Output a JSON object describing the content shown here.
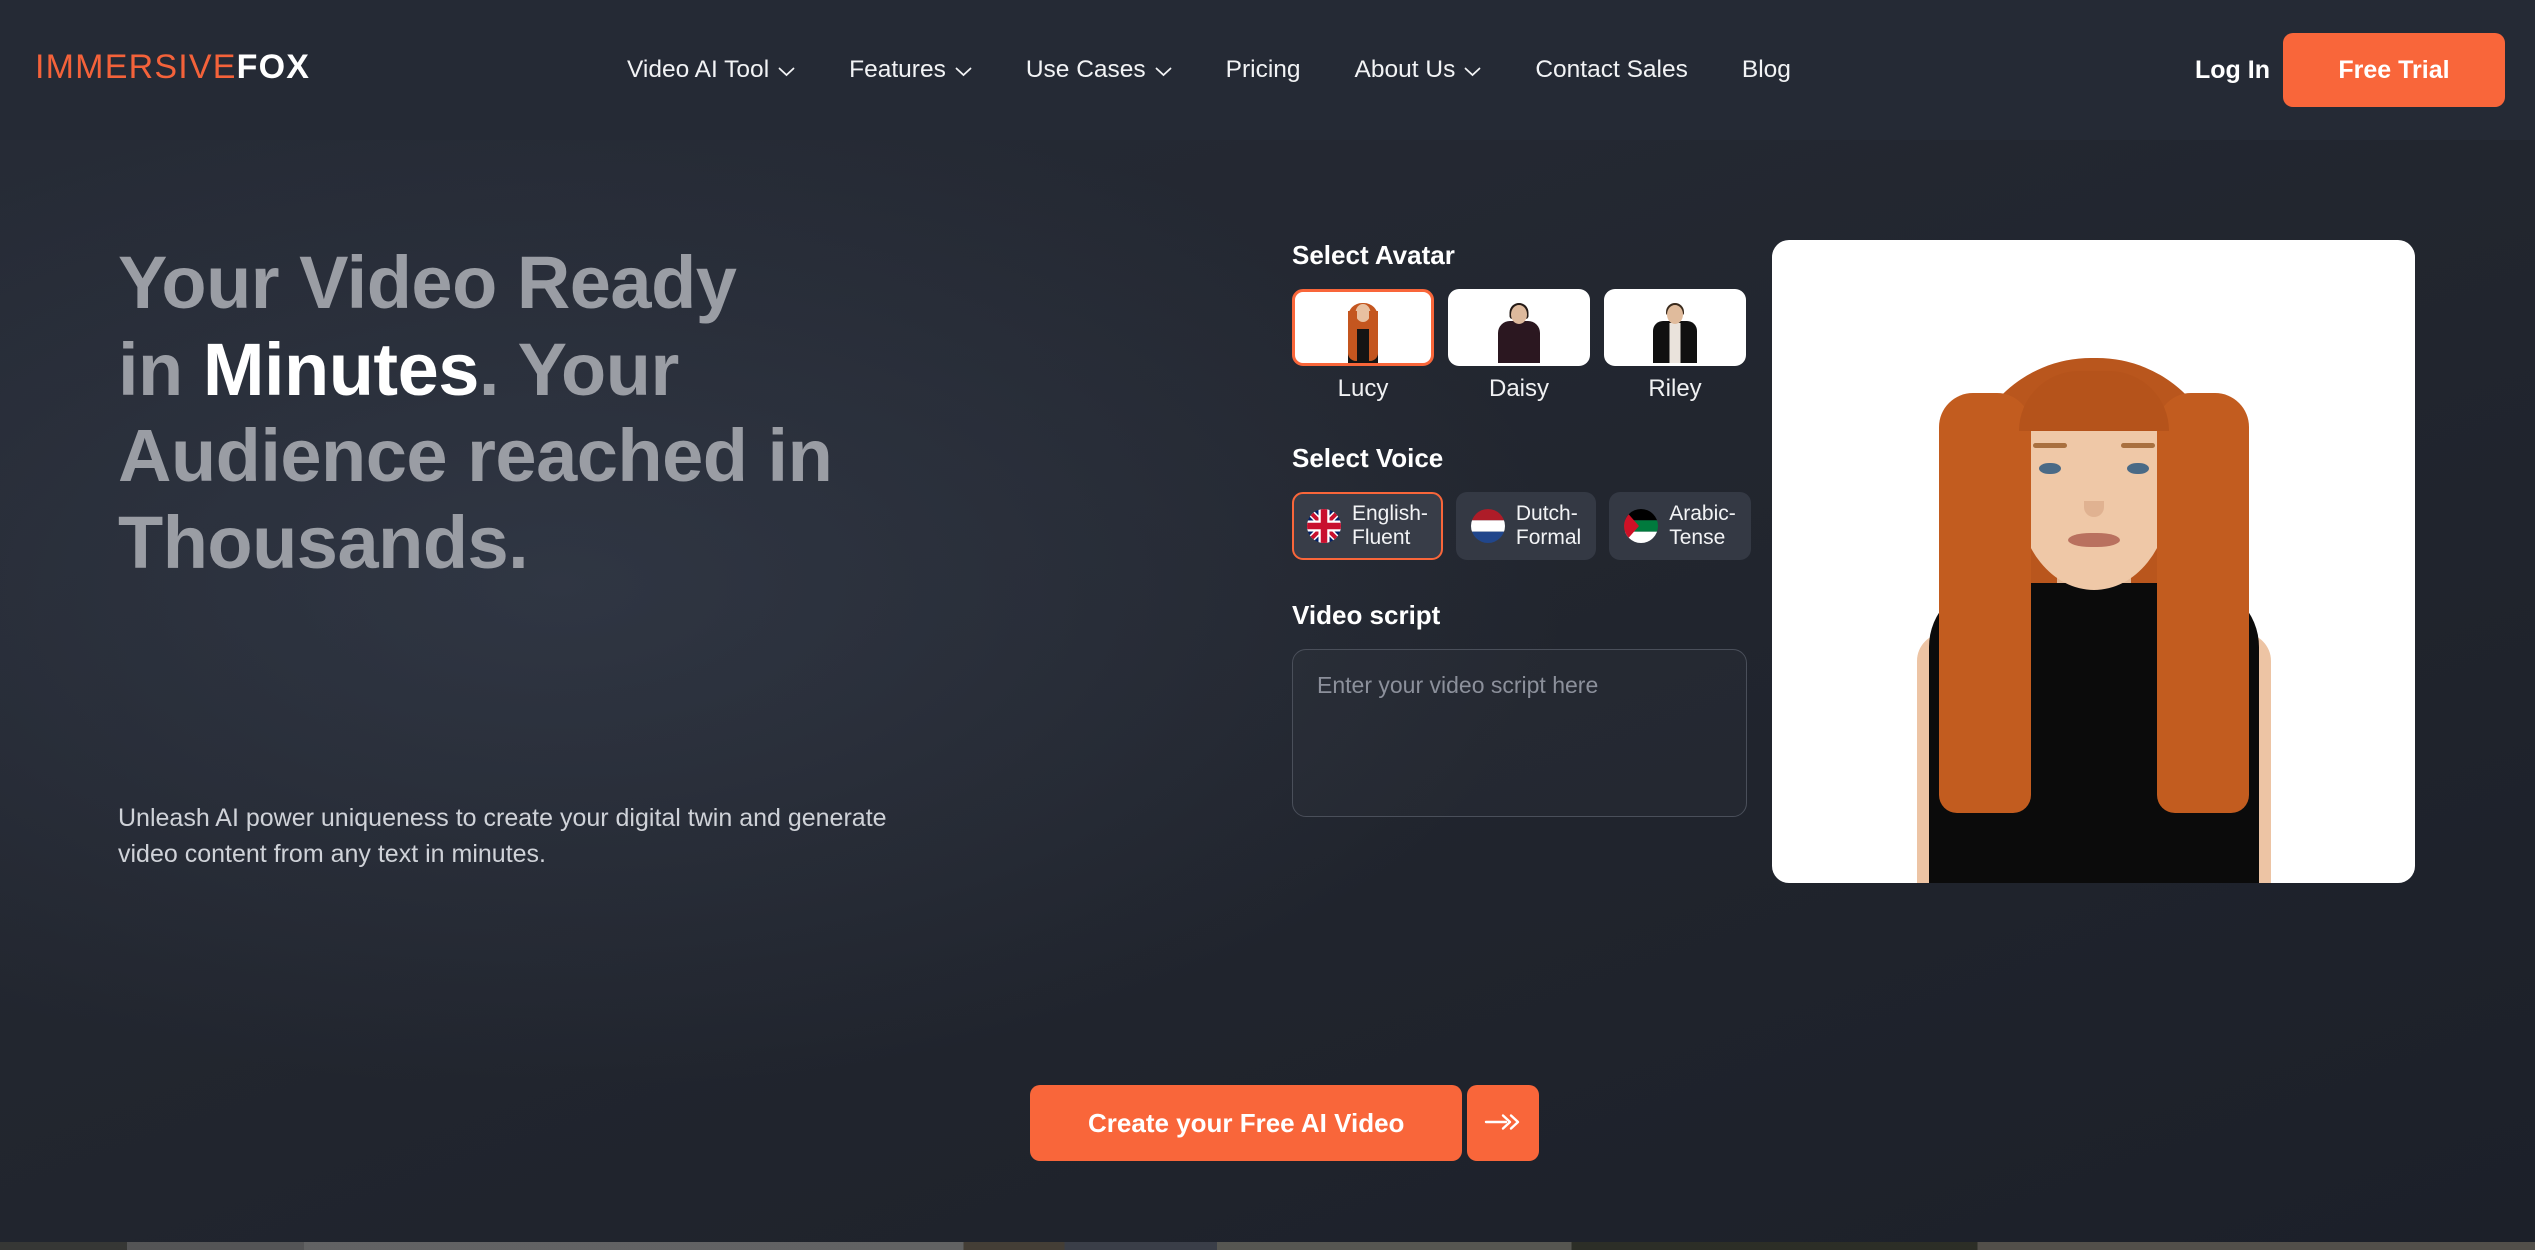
{
  "brand": {
    "name_part1": "IMMERSIVE",
    "name_part2": "FOX",
    "accent": "#f4623a"
  },
  "nav": {
    "items": [
      {
        "label": "Video AI Tool",
        "has_dropdown": true
      },
      {
        "label": "Features",
        "has_dropdown": true
      },
      {
        "label": "Use Cases",
        "has_dropdown": true
      },
      {
        "label": "Pricing",
        "has_dropdown": false
      },
      {
        "label": "About Us",
        "has_dropdown": true
      },
      {
        "label": "Contact Sales",
        "has_dropdown": false
      },
      {
        "label": "Blog",
        "has_dropdown": false
      }
    ],
    "login_label": "Log In",
    "free_trial_label": "Free Trial"
  },
  "hero": {
    "headline_line1": "Your Video Ready",
    "headline_line2_pre": "in ",
    "headline_line2_strong": "Minutes",
    "headline_line2_post": ". Your",
    "headline_line3": "Audience reached in",
    "headline_line4": "Thousands.",
    "subhead": "Unleash AI power uniqueness to create your digital twin and generate video content from any text in minutes."
  },
  "avatar_section": {
    "label": "Select Avatar",
    "avatars": [
      {
        "name": "Lucy",
        "selected": true
      },
      {
        "name": "Daisy",
        "selected": false
      },
      {
        "name": "Riley",
        "selected": false
      }
    ]
  },
  "voice_section": {
    "label": "Select Voice",
    "voices": [
      {
        "label": "English-\nFluent",
        "flag": "uk-flag-icon",
        "selected": true
      },
      {
        "label": "Dutch-\nFormal",
        "flag": "netherlands-flag-icon",
        "selected": false
      },
      {
        "label": "Arabic-\nTense",
        "flag": "palestine-flag-icon",
        "selected": false
      }
    ]
  },
  "script_section": {
    "label": "Video script",
    "placeholder": "Enter your video script here",
    "value": ""
  },
  "cta": {
    "label": "Create your Free AI Video",
    "arrow_icon": "double-arrow-right-icon",
    "color": "#f9663a"
  },
  "preview": {
    "avatar_shown": "Lucy"
  }
}
